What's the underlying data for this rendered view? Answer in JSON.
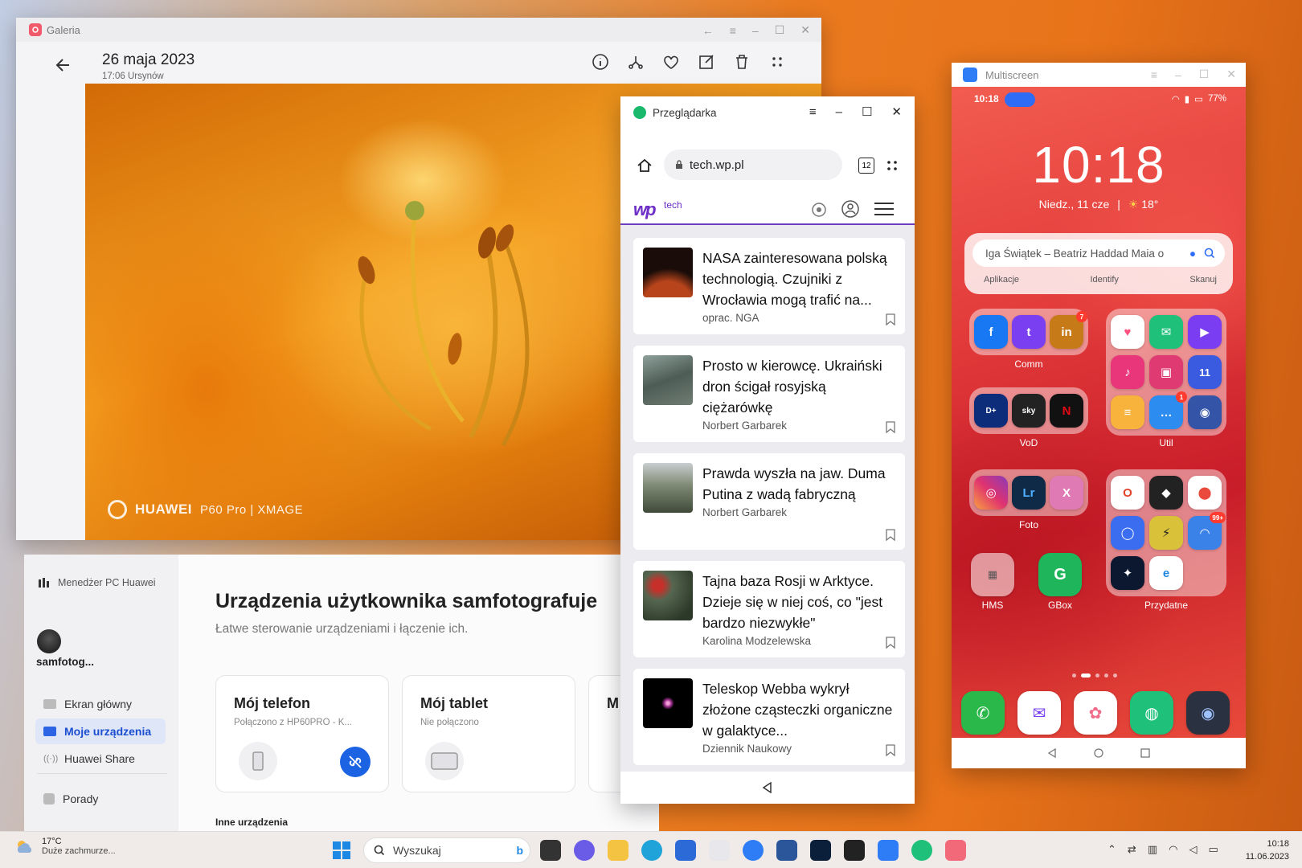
{
  "gallery": {
    "app_title": "Galeria",
    "date": "26 maja 2023",
    "subtitle": "17:06 Ursynów",
    "watermark_brand": "HUAWEI",
    "watermark_model": "P60 Pro | XMAGE",
    "toolbar_icons": [
      "info-icon",
      "share-icon",
      "heart-icon",
      "edit-icon",
      "trash-icon",
      "more-icon"
    ]
  },
  "pc_manager": {
    "brand": "Menedżer PC Huawei",
    "username": "samfotog...",
    "nav": [
      "Ekran główny",
      "Moje urządzenia",
      "Huawei Share",
      "Porady"
    ],
    "active_nav": "Moje urządzenia",
    "title": "Urządzenia użytkownika samfotografuje",
    "description": "Łatwe sterowanie urządzeniami i łączenie ich.",
    "cards": [
      {
        "title": "Mój telefon",
        "status": "Połączono z HP60PRO - K..."
      },
      {
        "title": "Mój tablet",
        "status": "Nie połączono"
      }
    ],
    "card3_partial": "M",
    "other_devices": "Inne urządzenia"
  },
  "browser": {
    "app_title": "Przeglądarka",
    "url": "tech.wp.pl",
    "tab_count": "12",
    "site_logo": "wp",
    "site_section": "tech",
    "articles": [
      {
        "headline": "NASA zainteresowana polską technologią. Czujniki z Wrocławia mogą trafić na...",
        "author": "oprac. NGA"
      },
      {
        "headline": "Prosto w kierowcę. Ukraiński dron ścigał rosyjską ciężarówkę",
        "author": "Norbert Garbarek"
      },
      {
        "headline": "Prawda wyszła na jaw. Duma Putina z wadą fabryczną",
        "author": "Norbert Garbarek"
      },
      {
        "headline": "Tajna baza Rosji w Arktyce. Dzieje się w niej coś, co \"jest bardzo niezwykłe\"",
        "author": "Karolina Modzelewska"
      },
      {
        "headline": "Teleskop Webba wykrył złożone cząsteczki organiczne w galaktyce...",
        "author": "Dziennik Naukowy"
      }
    ]
  },
  "multiscreen": {
    "app_title": "Multiscreen",
    "status_time": "10:18",
    "battery": "77%",
    "clock": "10:18",
    "date_line": "Niedz., 11 cze",
    "temperature": "18°",
    "search_text": "Iga Świątek – Beatriz Haddad Maia o",
    "chips": [
      "Aplikacje",
      "Identify",
      "Skanuj"
    ],
    "folders": [
      "Comm",
      "Util",
      "VoD",
      "Foto",
      "HMS",
      "GBox",
      "Przydatne"
    ],
    "badges": {
      "linkedin": "7",
      "messages": "1",
      "wifi_app": "99+",
      "calendar": "11"
    }
  },
  "taskbar": {
    "weather_temp": "17°C",
    "weather_desc": "Duże zachmurze...",
    "search_placeholder": "Wyszukaj",
    "time": "10:18",
    "date": "11.06.2023"
  }
}
